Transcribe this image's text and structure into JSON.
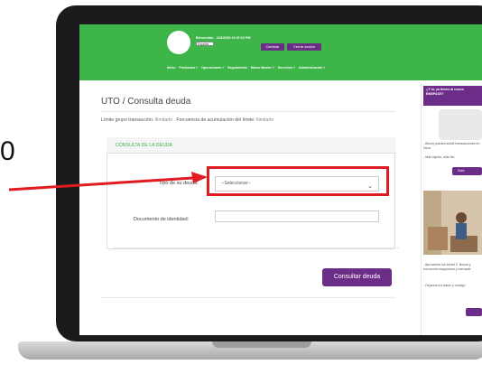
{
  "annotation": {
    "digit": "0"
  },
  "header": {
    "welcome": "Bienvenido - 12/6/2020 10:37:10 PM",
    "language": "Español",
    "change_label": "Cambiar",
    "logout_label": "Cerrar sesión",
    "menu": [
      "Inicio",
      "Productos ˅",
      "Operaciones ˅",
      "Seguimiento",
      "Marco Master ˅",
      "Servicios ˅",
      "Administración ˅"
    ]
  },
  "main": {
    "page_title": "UTO / Consulta deuda",
    "limits": {
      "group_label": "Límite grupo transacción:",
      "group_value": "Ilimitado",
      "freq_label": "Frecuencia de acumulación del límite:",
      "freq_value": "Ilimitado"
    },
    "card_title": "CONSULTA DE LA DEUDA",
    "debt_type_label": "Tipo de su deuda:",
    "debt_type_value": "--Seleccionar--",
    "id_label": "Documento de identidad:",
    "id_value": "",
    "consult_label": "Consultar deuda"
  },
  "sidebar": {
    "banner": "¿Y tú, ya tienes al nuevo BNBPASS?",
    "text1": "- Ahora puedes solicit transacciones en línea",
    "text2": "- Más rápido, más fác",
    "button1": "Solic",
    "text3": "- Aprovecha los benef 0. Busca y encuentra maquinaria y mercade",
    "text4": "- Déjanos tus datos y contigo."
  },
  "colors": {
    "green": "#3db549",
    "purple": "#6b2d87",
    "highlight": "#e11b22"
  }
}
